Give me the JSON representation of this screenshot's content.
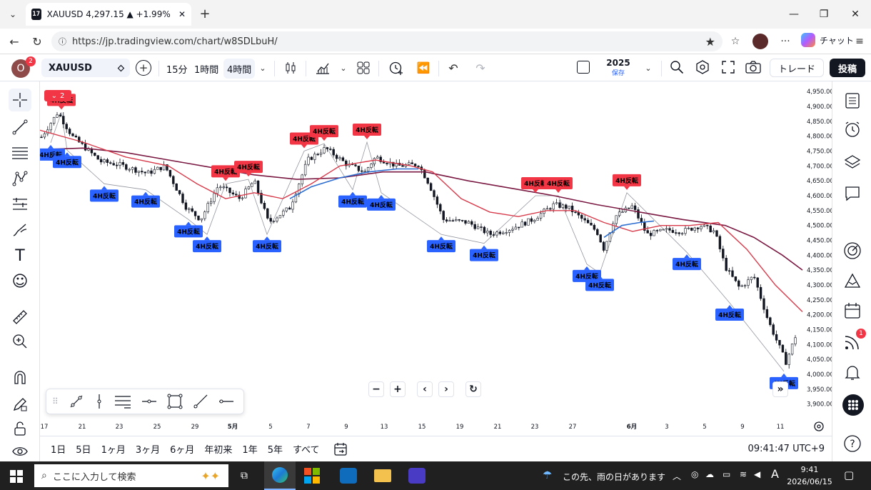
{
  "browser": {
    "tab_title": "XAUUSD 4,297.15 ▲ +1.99% 2025",
    "url": "https://jp.tradingview.com/chart/w8SDLbuH/",
    "copilot_label": "チャット"
  },
  "toolbar": {
    "avatar_letter": "O",
    "avatar_badge": "2",
    "symbol": "XAUUSD",
    "interval_15m": "15分",
    "interval_1h": "1時間",
    "interval_4h": "4時間",
    "layout_name": "2025",
    "layout_status": "保存",
    "trade_label": "トレード",
    "publish_label": "投稿"
  },
  "chart": {
    "collapse_count": "2",
    "signal_label": "4H反転",
    "price_ticks": [
      "4,950.00",
      "4,900.00",
      "4,850.00",
      "4,800.00",
      "4,750.00",
      "4,700.00",
      "4,650.00",
      "4,600.00",
      "4,550.00",
      "4,500.00",
      "4,450.00",
      "4,400.00",
      "4,350.00",
      "4,300.00",
      "4,250.00",
      "4,200.00",
      "4,150.00",
      "4,100.00",
      "4,050.00",
      "4,000.00",
      "3,950.00",
      "3,900.00"
    ],
    "date_ticks": [
      "17",
      "21",
      "23",
      "25",
      "29",
      "5月",
      "5",
      "7",
      "9",
      "13",
      "15",
      "19",
      "21",
      "23",
      "27",
      "6月",
      "3",
      "5",
      "9",
      "11"
    ],
    "ylim": [
      3880,
      4960
    ]
  },
  "ranges": [
    "1日",
    "5日",
    "1ヶ月",
    "3ヶ月",
    "6ヶ月",
    "年初来",
    "1年",
    "5年",
    "すべて"
  ],
  "clock": "09:41:47 UTC+9",
  "notifications_badge": "1",
  "taskbar": {
    "search_placeholder": "ここに入力して検索",
    "weather": "この先、雨の日があります",
    "time": "9:41",
    "date": "2026/06/15"
  },
  "colors": {
    "accent": "#2962ff",
    "down": "#f23645",
    "ma_red": "#d83c4c",
    "ma_maroon": "#7b1a43",
    "ma_blue": "#2f6fd1"
  }
}
